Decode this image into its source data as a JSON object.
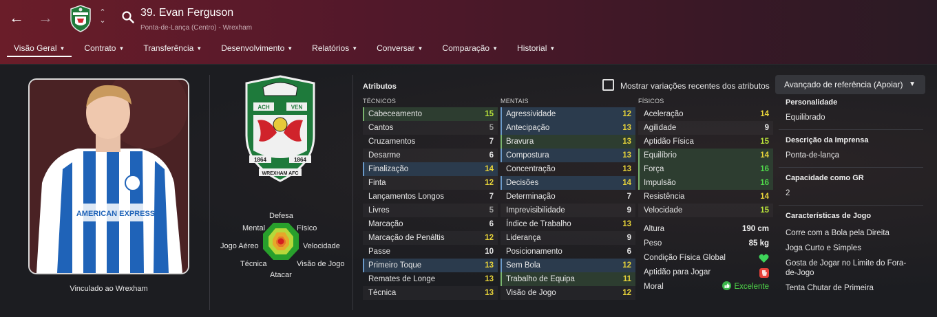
{
  "header": {
    "player_name": "39. Evan Ferguson",
    "player_sub": "Ponta-de-Lança (Centro) - Wrexham",
    "tabs": [
      {
        "label": "Visão Geral"
      },
      {
        "label": "Contrato"
      },
      {
        "label": "Transferência"
      },
      {
        "label": "Desenvolvimento"
      },
      {
        "label": "Relatórios"
      },
      {
        "label": "Conversar"
      },
      {
        "label": "Comparação"
      },
      {
        "label": "Historial"
      }
    ],
    "colors": {
      "header_start": "#6a1d29",
      "header_end": "#2a1a24"
    }
  },
  "profile": {
    "contract_status": "Vinculado ao Wrexham"
  },
  "crest": {
    "banner_left": "ACH",
    "banner_right": "VEN",
    "year_left": "1864",
    "year_right": "1864",
    "name": "WREXHAM AFC"
  },
  "radar": {
    "labels": {
      "top": "Defesa",
      "top_left": "Mental",
      "top_right": "Físico",
      "left": "Jogo Aéreo",
      "right": "Velocidade",
      "bottom_left": "Técnica",
      "bottom_right": "Visão de Jogo",
      "bottom": "Atacar"
    }
  },
  "attributes": {
    "title": "Atributos",
    "show_changes_label": "Mostrar variações recentes dos atributos",
    "show_changes_checked": false,
    "role_dropdown": "Avançado de referência (Apoiar)",
    "tecnicos": {
      "heading": "TÉCNICOS",
      "rows": [
        {
          "label": "Cabeceamento",
          "value": "15",
          "hl": "green",
          "tone": "lime"
        },
        {
          "label": "Cantos",
          "value": "5",
          "hl": "",
          "tone": "grey"
        },
        {
          "label": "Cruzamentos",
          "value": "7",
          "hl": "",
          "tone": "white"
        },
        {
          "label": "Desarme",
          "value": "6",
          "hl": "",
          "tone": "white"
        },
        {
          "label": "Finalização",
          "value": "14",
          "hl": "blue",
          "tone": "yellow"
        },
        {
          "label": "Finta",
          "value": "12",
          "hl": "",
          "tone": "yellow"
        },
        {
          "label": "Lançamentos Longos",
          "value": "7",
          "hl": "",
          "tone": "white"
        },
        {
          "label": "Livres",
          "value": "5",
          "hl": "",
          "tone": "grey"
        },
        {
          "label": "Marcação",
          "value": "6",
          "hl": "",
          "tone": "white"
        },
        {
          "label": "Marcação de Penáltis",
          "value": "12",
          "hl": "",
          "tone": "yellow"
        },
        {
          "label": "Passe",
          "value": "10",
          "hl": "",
          "tone": "white"
        },
        {
          "label": "Primeiro Toque",
          "value": "13",
          "hl": "blue",
          "tone": "yellow"
        },
        {
          "label": "Remates de Longe",
          "value": "13",
          "hl": "",
          "tone": "yellow"
        },
        {
          "label": "Técnica",
          "value": "13",
          "hl": "",
          "tone": "yellow"
        }
      ]
    },
    "mentais": {
      "heading": "MENTAIS",
      "rows": [
        {
          "label": "Agressividade",
          "value": "12",
          "hl": "blue",
          "tone": "yellow"
        },
        {
          "label": "Antecipação",
          "value": "13",
          "hl": "blue",
          "tone": "yellow"
        },
        {
          "label": "Bravura",
          "value": "13",
          "hl": "green",
          "tone": "yellow"
        },
        {
          "label": "Compostura",
          "value": "13",
          "hl": "blue",
          "tone": "yellow"
        },
        {
          "label": "Concentração",
          "value": "13",
          "hl": "",
          "tone": "yellow"
        },
        {
          "label": "Decisões",
          "value": "14",
          "hl": "blue",
          "tone": "yellow"
        },
        {
          "label": "Determinação",
          "value": "7",
          "hl": "",
          "tone": "white"
        },
        {
          "label": "Imprevisibilidade",
          "value": "9",
          "hl": "",
          "tone": "white"
        },
        {
          "label": "Índice de Trabalho",
          "value": "13",
          "hl": "",
          "tone": "yellow"
        },
        {
          "label": "Liderança",
          "value": "9",
          "hl": "",
          "tone": "white"
        },
        {
          "label": "Posicionamento",
          "value": "6",
          "hl": "",
          "tone": "white"
        },
        {
          "label": "Sem Bola",
          "value": "12",
          "hl": "blue",
          "tone": "yellow"
        },
        {
          "label": "Trabalho de Equipa",
          "value": "11",
          "hl": "green",
          "tone": "yellow"
        },
        {
          "label": "Visão de Jogo",
          "value": "12",
          "hl": "",
          "tone": "yellow"
        }
      ]
    },
    "fisicos": {
      "heading": "FÍSICOS",
      "rows": [
        {
          "label": "Aceleração",
          "value": "14",
          "hl": "",
          "tone": "yellow"
        },
        {
          "label": "Agilidade",
          "value": "9",
          "hl": "",
          "tone": "white"
        },
        {
          "label": "Aptidão Física",
          "value": "15",
          "hl": "",
          "tone": "lime"
        },
        {
          "label": "Equilíbrio",
          "value": "14",
          "hl": "green",
          "tone": "yellow"
        },
        {
          "label": "Força",
          "value": "16",
          "hl": "green",
          "tone": "green"
        },
        {
          "label": "Impulsão",
          "value": "16",
          "hl": "green",
          "tone": "green"
        },
        {
          "label": "Resistência",
          "value": "14",
          "hl": "",
          "tone": "yellow"
        },
        {
          "label": "Velocidade",
          "value": "15",
          "hl": "",
          "tone": "lime"
        }
      ]
    },
    "physical_info": {
      "height_label": "Altura",
      "height_value": "190 cm",
      "weight_label": "Peso",
      "weight_value": "85 kg",
      "condition_label": "Condição Física Global",
      "condition_icon": "heart-icon",
      "fitness_label": "Aptidão para Jogar",
      "fitness_icon": "match-fitness-icon",
      "morale_label": "Moral",
      "morale_value": "Excelente",
      "morale_icon": "thumbs-up-icon"
    }
  },
  "info_panel": {
    "personality_head": "Personalidade",
    "personality_val": "Equilibrado",
    "press_head": "Descrição da Imprensa",
    "press_val": "Ponta-de-lança",
    "gk_head": "Capacidade como GR",
    "gk_val": "2",
    "traits_head": "Características de Jogo",
    "traits": [
      "Corre com a Bola pela Direita",
      "Joga Curto e Simples",
      "Gosta de Jogar no Limite do Fora-de-Jogo",
      "Tenta Chutar de Primeira"
    ]
  }
}
